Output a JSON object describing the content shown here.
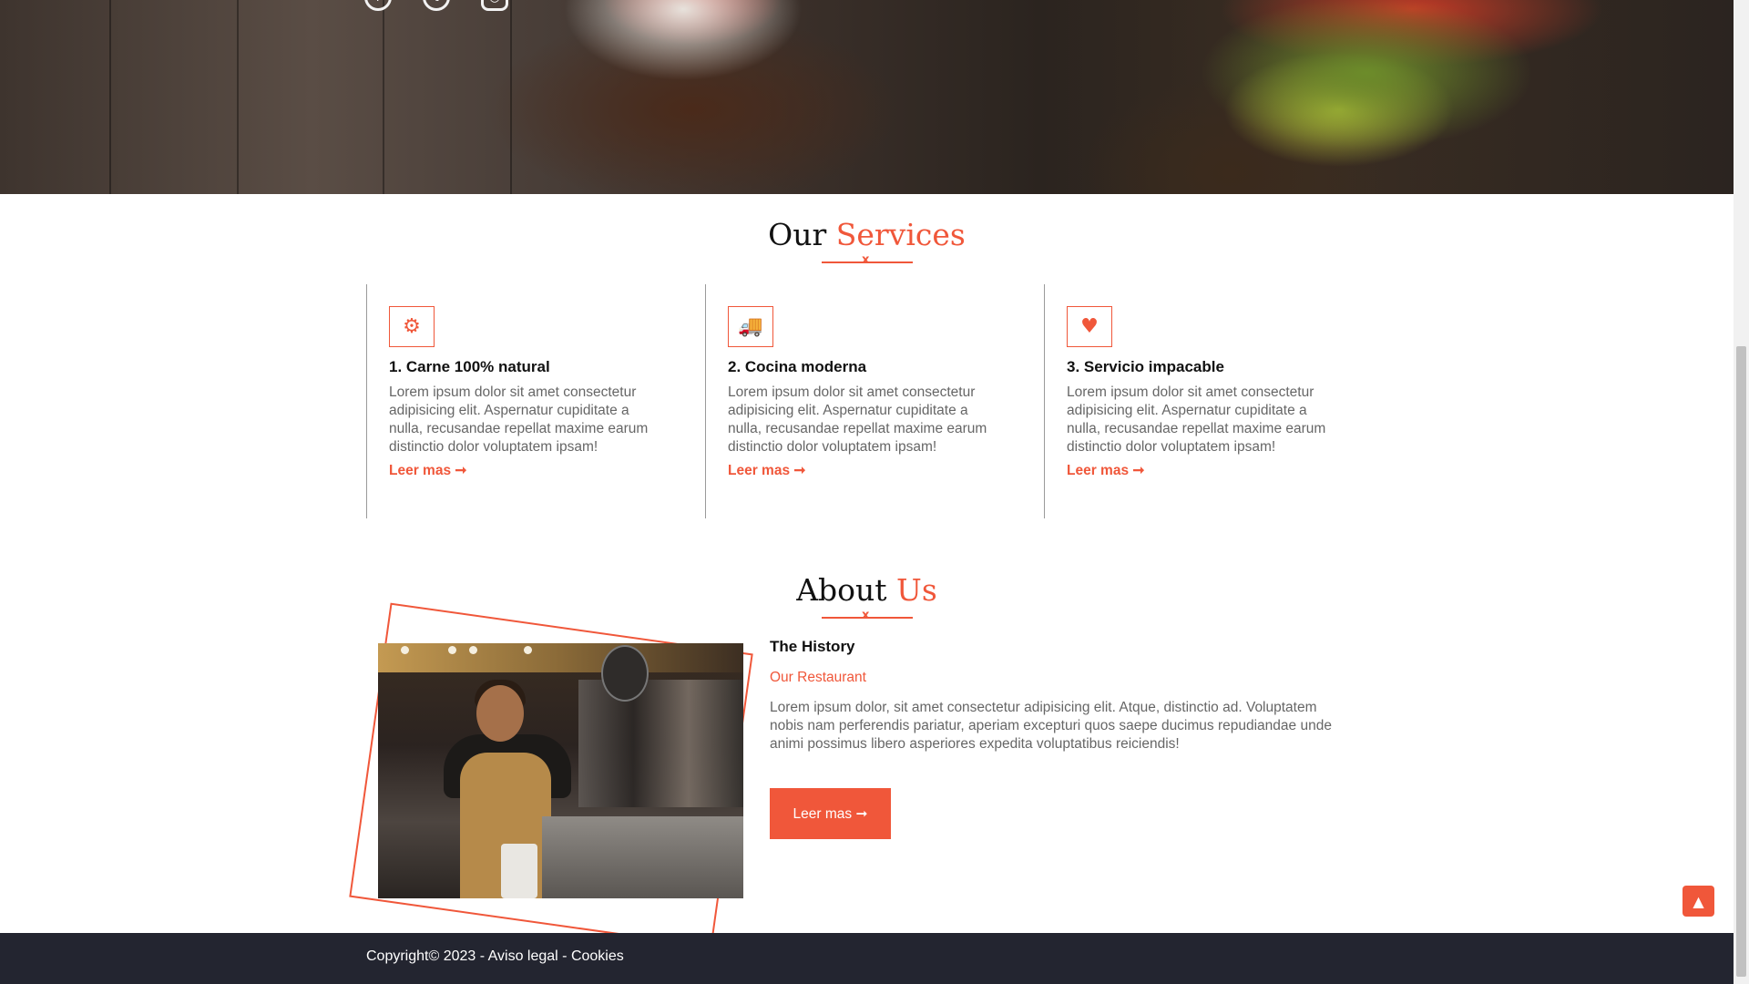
{
  "hero": {
    "social_icons": [
      "facebook-icon",
      "twitter-icon",
      "instagram-icon"
    ]
  },
  "services": {
    "title_main": "Our",
    "title_accent": "Services",
    "divider_mark": "x",
    "cards": [
      {
        "icon": "gears-icon",
        "glyph": "⚙",
        "title": "1. Carne 100% natural",
        "text": "Lorem ipsum dolor sit amet consectetur adipisicing elit. Aspernatur cupiditate a nulla, recusandae repellat maxime earum distinctio dolor voluptatem ipsam!",
        "link": "Leer mas ➞"
      },
      {
        "icon": "truck-icon",
        "glyph": "🚚",
        "title": "2. Cocina moderna",
        "text": "Lorem ipsum dolor sit amet consectetur adipisicing elit. Aspernatur cupiditate a nulla, recusandae repellat maxime earum distinctio dolor voluptatem ipsam!",
        "link": "Leer mas ➞"
      },
      {
        "icon": "heart-icon",
        "glyph": "♥",
        "title": "3. Servicio impacable",
        "text": "Lorem ipsum dolor sit amet consectetur adipisicing elit. Aspernatur cupiditate a nulla, recusandae repellat maxime earum distinctio dolor voluptatem ipsam!",
        "link": "Leer mas ➞"
      }
    ]
  },
  "about": {
    "title_main": "About",
    "title_accent": "Us",
    "divider_mark": "x",
    "heading": "The History",
    "subheading": "Our Restaurant",
    "paragraph": "Lorem ipsum dolor, sit amet consectetur adipisicing elit. Atque, distinctio ad. Voluptatem nobis nam perferendis pariatur, aperiam excepturi quos saepe ducimus repudiandae unde animi possimus libero asperiores expedita voluptatibus reiciendis!",
    "button": "Leer mas ➞"
  },
  "back_to_top": {
    "icon": "arrow-up-icon",
    "glyph": "▲"
  },
  "footer": {
    "text": "Copyright© 2023 - Aviso legal - Cookies"
  },
  "colors": {
    "accent": "#f0573a",
    "footer_bg": "#232530",
    "body_text": "#666666"
  }
}
